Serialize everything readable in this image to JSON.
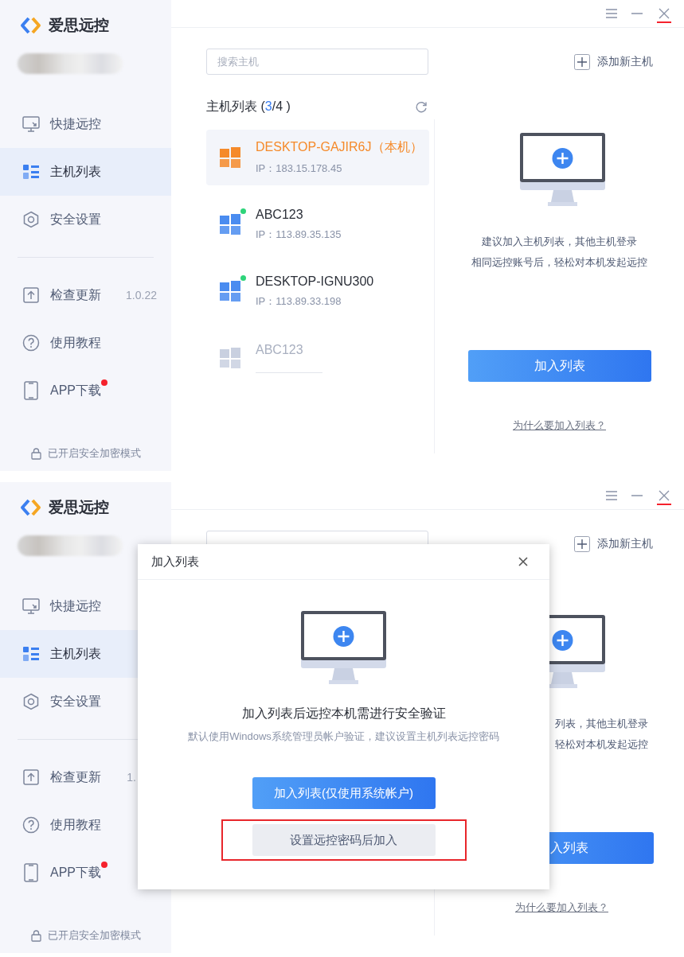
{
  "windows": [
    {
      "app_name": "爱思远控",
      "nav": [
        {
          "label": "快捷远控",
          "kind": "remote",
          "selected": false
        },
        {
          "label": "主机列表",
          "kind": "hosts",
          "selected": true
        },
        {
          "label": "安全设置",
          "kind": "security",
          "selected": false
        }
      ],
      "tools": [
        {
          "label": "检查更新",
          "kind": "update",
          "version": "1.0.22",
          "badge": false
        },
        {
          "label": "使用教程",
          "kind": "help",
          "badge": false
        },
        {
          "label": "APP下载",
          "kind": "phone",
          "badge": true
        }
      ],
      "footer": "已开启安全加密模式",
      "search": {
        "placeholder": "搜索主机"
      },
      "add_host": "添加新主机",
      "host_list": {
        "title": "主机列表 (",
        "count": "3",
        "total": "/4 )",
        "hosts": [
          {
            "name": "DESKTOP-GAJIR6J（本机）",
            "ip": "IP：183.15.178.45",
            "selected": true,
            "local": true,
            "online": false,
            "disabled": false
          },
          {
            "name": "ABC123",
            "ip": "IP：113.89.35.135",
            "selected": false,
            "local": false,
            "online": true,
            "disabled": false
          },
          {
            "name": "DESKTOP-IGNU300",
            "ip": "IP：113.89.33.198",
            "selected": false,
            "local": false,
            "online": true,
            "disabled": false
          },
          {
            "name": "ABC123",
            "selected": false,
            "local": false,
            "online": false,
            "disabled": true
          }
        ]
      },
      "panel": {
        "hint": [
          "建议加入主机列表，其他主机登录",
          "相同远控账号后，轻松对本机发起远控"
        ],
        "button": "加入列表",
        "link": "为什么要加入列表？"
      }
    },
    {
      "app_name": "爱思远控",
      "nav": [
        {
          "label": "快捷远控",
          "kind": "remote",
          "selected": false
        },
        {
          "label": "主机列表",
          "kind": "hosts",
          "selected": true
        },
        {
          "label": "安全设置",
          "kind": "security",
          "selected": false
        }
      ],
      "tools": [
        {
          "label": "检查更新",
          "kind": "update",
          "version": "1.",
          "badge": false
        },
        {
          "label": "使用教程",
          "kind": "help",
          "badge": false
        },
        {
          "label": "APP下载",
          "kind": "phone",
          "badge": true
        }
      ],
      "footer": "已开启安全加密模式",
      "add_host": "添加新主机",
      "panel": {
        "hint": [
          "列表，其他主机登录",
          "轻松对本机发起远控"
        ],
        "button": "入列表",
        "link": "为什么要加入列表？"
      },
      "dialog": {
        "title": "加入列表",
        "heading": "加入列表后远控本机需进行安全验证",
        "note": "默认使用Windows系统管理员帐户验证，建议设置主机列表远控密码",
        "buttons": [
          {
            "label": "加入列表(仅使用系统帐户)",
            "kind": "primary",
            "highlighted": false
          },
          {
            "label": "设置远控密码后加入",
            "kind": "secondary",
            "highlighted": true
          }
        ]
      }
    }
  ]
}
